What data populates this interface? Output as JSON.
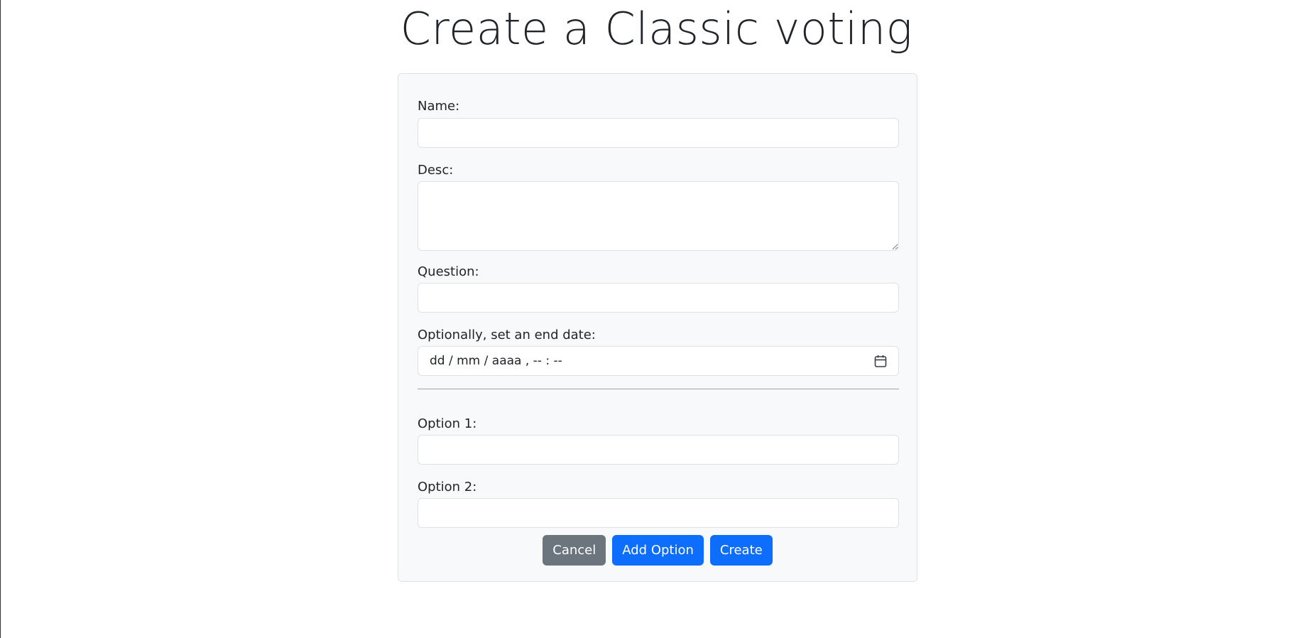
{
  "page": {
    "title": "Create a Classic voting"
  },
  "form": {
    "name_label": "Name:",
    "name_value": "",
    "desc_label": "Desc:",
    "desc_value": "",
    "question_label": "Question:",
    "question_value": "",
    "end_date_label": "Optionally, set an end date:",
    "end_date_placeholder": "dd / mm / aaaa ,  -- : --",
    "options": [
      {
        "label": "Option 1:",
        "value": ""
      },
      {
        "label": "Option 2:",
        "value": ""
      }
    ]
  },
  "buttons": {
    "cancel": "Cancel",
    "add_option": "Add Option",
    "create": "Create"
  },
  "icons": {
    "calendar": "calendar-icon"
  },
  "colors": {
    "primary": "#0d6efd",
    "secondary": "#6c757d",
    "card_bg": "#f8f9fa",
    "border": "#dee2e6"
  }
}
